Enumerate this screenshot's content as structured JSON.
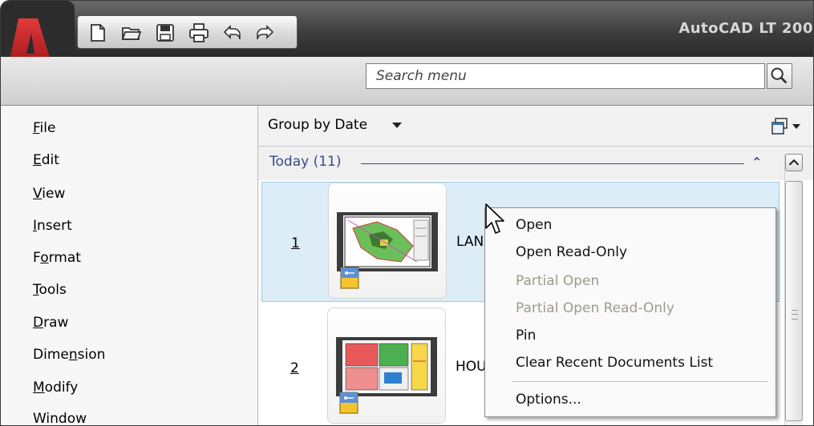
{
  "window": {
    "title": "AutoCAD LT 200"
  },
  "quick_access": {
    "icons": [
      "new-icon",
      "open-icon",
      "save-icon",
      "print-icon",
      "undo-icon",
      "redo-icon"
    ]
  },
  "search": {
    "placeholder": "Search menu",
    "value": ""
  },
  "left_menu": {
    "items": [
      {
        "pre": "",
        "u": "F",
        "post": "ile"
      },
      {
        "pre": "",
        "u": "E",
        "post": "dit"
      },
      {
        "pre": "",
        "u": "V",
        "post": "iew"
      },
      {
        "pre": "",
        "u": "I",
        "post": "nsert"
      },
      {
        "pre": "F",
        "u": "o",
        "post": "rmat"
      },
      {
        "pre": "",
        "u": "T",
        "post": "ools"
      },
      {
        "pre": "",
        "u": "D",
        "post": "raw"
      },
      {
        "pre": "Dime",
        "u": "n",
        "post": "sion"
      },
      {
        "pre": "",
        "u": "M",
        "post": "odify"
      },
      {
        "pre": "",
        "u": "",
        "post": "Window"
      }
    ]
  },
  "documents_panel": {
    "group_by_label": "Group by Date",
    "group_header": "Today (11)",
    "documents": [
      {
        "number": "1",
        "name": "LAN",
        "selected": true
      },
      {
        "number": "2",
        "name": "HOU",
        "selected": false
      }
    ]
  },
  "context_menu": {
    "items": [
      {
        "label": "Open",
        "enabled": true
      },
      {
        "label": "Open Read-Only",
        "enabled": true
      },
      {
        "label": "Partial Open",
        "enabled": false
      },
      {
        "label": "Partial Open Read-Only",
        "enabled": false
      },
      {
        "label": "Pin",
        "enabled": true
      },
      {
        "label": "Clear Recent Documents List",
        "enabled": true
      },
      {
        "label": "Options...",
        "enabled": true
      }
    ]
  },
  "colors": {
    "accent_red": "#c8202a",
    "group_header_blue": "#3a4a8a",
    "selection_bg": "#dcedf8",
    "disabled_text": "#a09a8c"
  }
}
